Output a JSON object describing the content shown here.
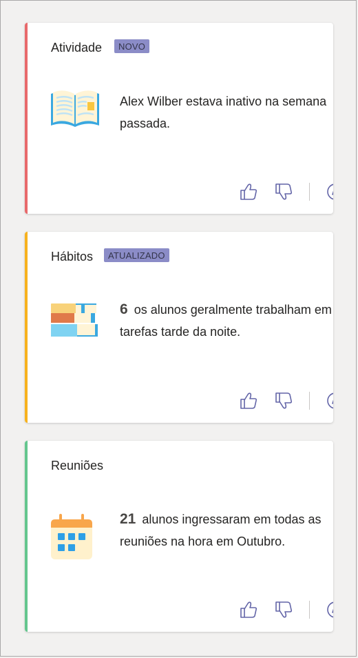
{
  "cards": [
    {
      "title": "Atividade",
      "badge": "NOVO",
      "accent": "#e8696b",
      "icon": "open-book-icon",
      "number": "",
      "message": "Alex Wilber estava inativo na semana passada."
    },
    {
      "title": "Hábitos",
      "badge": "ATUALIZADO",
      "accent": "#f7b21e",
      "icon": "book-stack-icon",
      "number": "6",
      "message": "os alunos geralmente trabalham em tarefas tarde da noite."
    },
    {
      "title": "Reuniões",
      "badge": "",
      "accent": "#64c68e",
      "icon": "calendar-icon",
      "number": "21",
      "message": "alunos ingressaram em todas as reuniões na hora em Outubro."
    }
  ],
  "actions": {
    "like_icon": "thumbs-up-icon",
    "dislike_icon": "thumbs-down-icon",
    "explore_icon": "compass-icon"
  },
  "colors": {
    "icon_stroke": "#6264a7",
    "badge_bg": "#8b8cc7"
  }
}
